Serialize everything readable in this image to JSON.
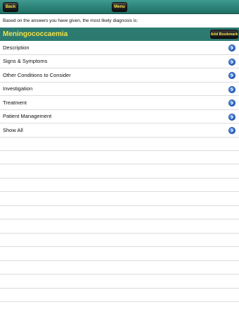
{
  "topbar": {
    "back_label": "Back",
    "menu_label": "Menu"
  },
  "intro_text": "Based on the answers you have given, the most likely diagnosis is:",
  "diagnosis": {
    "title": "Meningococcaemia",
    "bookmark_label": "Add Bookmark"
  },
  "items": [
    {
      "label": "Description"
    },
    {
      "label": "Signs & Symptoms"
    },
    {
      "label": "Other Conditions to Consider"
    },
    {
      "label": "Investigation"
    },
    {
      "label": "Treatment"
    },
    {
      "label": "Patient Management"
    },
    {
      "label": "Show All"
    }
  ],
  "icons": {
    "disclosure": "chevron-right-circle-icon"
  },
  "colors": {
    "header_bg": "#2d7b70",
    "title_yellow": "#f0e24a",
    "disclosure_blue": "#2a62c7"
  }
}
